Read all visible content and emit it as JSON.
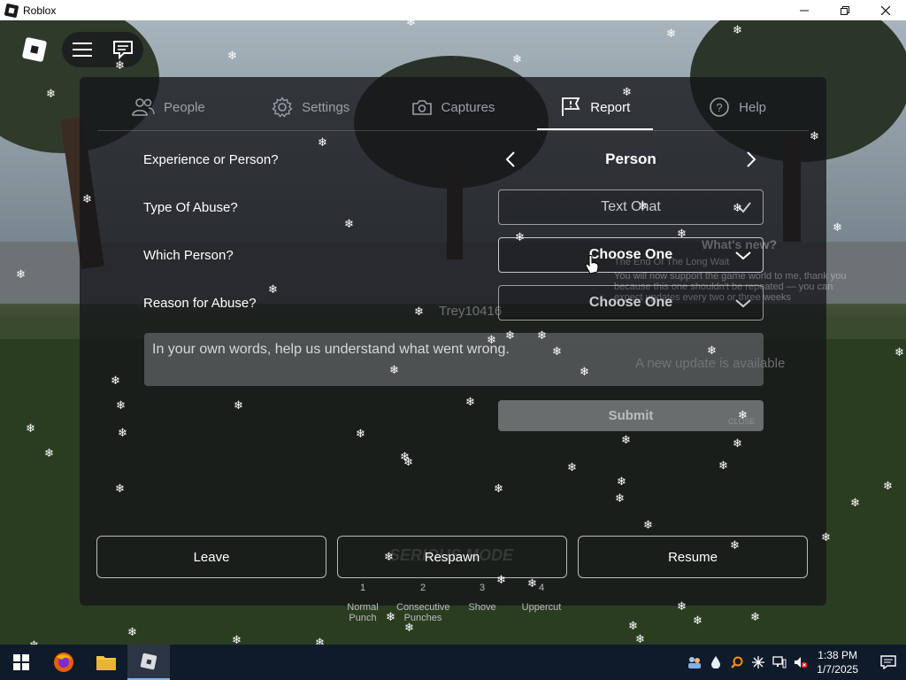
{
  "window": {
    "title": "Roblox",
    "controls": [
      "minimize",
      "maximize",
      "close"
    ]
  },
  "tabs": [
    {
      "label": "People",
      "icon": "people-icon"
    },
    {
      "label": "Settings",
      "icon": "gear-icon"
    },
    {
      "label": "Captures",
      "icon": "camera-icon"
    },
    {
      "label": "Report",
      "icon": "report-flag-icon",
      "active": true
    },
    {
      "label": "Help",
      "icon": "help-icon"
    }
  ],
  "form": {
    "experience_label": "Experience or Person?",
    "experience_value": "Person",
    "abuse_type_label": "Type Of Abuse?",
    "abuse_type_value": "Text Chat",
    "which_person_label": "Which Person?",
    "which_person_value": "Choose One",
    "reason_label": "Reason for Abuse?",
    "reason_value": "Choose One",
    "description_placeholder": "In your own words, help us understand what went wrong.",
    "submit_label": "Submit"
  },
  "bottom_buttons": {
    "leave": "Leave",
    "respawn": "Respawn",
    "resume": "Resume"
  },
  "hotbar": [
    {
      "num": "1",
      "label": "Normal Punch"
    },
    {
      "num": "2",
      "label": "Consecutive Punches"
    },
    {
      "num": "3",
      "label": "Shove"
    },
    {
      "num": "4",
      "label": "Uppercut"
    }
  ],
  "background": {
    "player_name": "Trey10416",
    "sign_title": "What's new?",
    "sign_line1": "The End Of The Long Wait",
    "sign_line2": "You will now support the game world to me, thank you because this one shouldn't be repeated — you can expect updates every two or three weeks",
    "sign_line3": "A new update is available",
    "sign_close": "CLOSE",
    "mode_text": "SERIOUS MODE"
  },
  "taskbar": {
    "time": "1:38 PM",
    "date": "1/7/2025",
    "apps": [
      "windows-start-icon",
      "firefox-icon",
      "file-explorer-icon",
      "roblox-app-icon"
    ]
  },
  "colors": {
    "panel": "#141619",
    "active_tab": "#ffffff",
    "inactive_tab": "#9aa0a6",
    "taskbar": "#0f1a2a"
  }
}
